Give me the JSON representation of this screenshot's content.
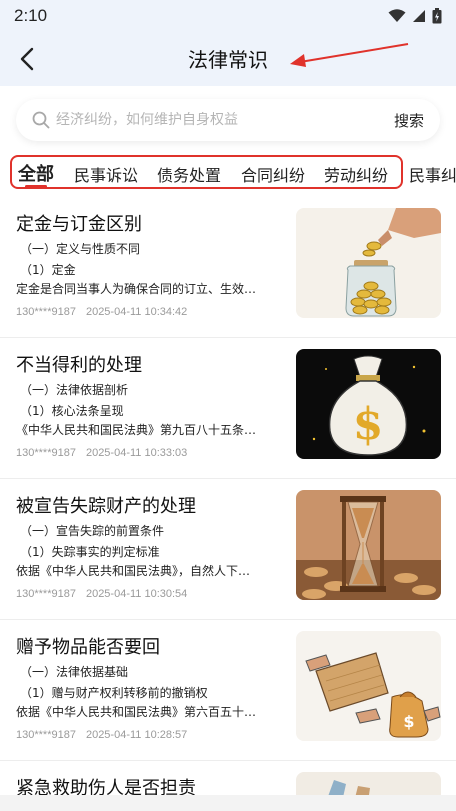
{
  "status_bar": {
    "time": "2:10"
  },
  "header": {
    "title": "法律常识"
  },
  "search": {
    "placeholder": "经济纠纷，如何维护自身权益",
    "button_label": "搜索"
  },
  "tabs": [
    {
      "label": "全部",
      "active": true
    },
    {
      "label": "民事诉讼"
    },
    {
      "label": "债务处置"
    },
    {
      "label": "合同纠纷"
    },
    {
      "label": "劳动纠纷"
    },
    {
      "label": "民事纠"
    }
  ],
  "articles": [
    {
      "title": "定金与订金区别",
      "line1": "（一）定义与性质不同",
      "line2": "（1）定金",
      "excerpt": "定金是合同当事人为确保合同的订立、生效…",
      "author": "130****9187",
      "time": "2025-04-11 10:34:42",
      "thumb": "hand-coins-jar-image"
    },
    {
      "title": "不当得利的处理",
      "line1": "（一）法律依据剖析",
      "line2": "（1）核心法条呈现",
      "excerpt": "《中华人民共和国民法典》第九百八十五条…",
      "author": "130****9187",
      "time": "2025-04-11 10:33:03",
      "thumb": "money-bag-image"
    },
    {
      "title": "被宣告失踪财产的处理",
      "line1": "（一）宣告失踪的前置条件",
      "line2": "（1）失踪事实的判定标准",
      "excerpt": "依据《中华人民共和国民法典》，自然人下…",
      "author": "130****9187",
      "time": "2025-04-11 10:30:54",
      "thumb": "hourglass-coins-image"
    },
    {
      "title": "赠予物品能否要回",
      "line1": "（一）法律依据基础",
      "line2": "（1）赠与财产权利转移前的撤销权",
      "excerpt": "依据《中华人民共和国民法典》第六百五十…",
      "author": "130****9187",
      "time": "2025-04-11 10:28:57",
      "thumb": "gift-exchange-image"
    },
    {
      "title": "紧急救助伤人是否担责",
      "thumb": "rescue-image"
    }
  ],
  "colors": {
    "accent": "#e0322b",
    "header_bg": "#eef3fb",
    "meta_gray": "#9a9a9a"
  }
}
